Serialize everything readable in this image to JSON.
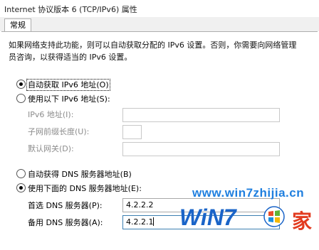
{
  "window": {
    "title": "Internet 协议版本 6 (TCP/IPv6) 属性"
  },
  "tabs": [
    {
      "label": "常规"
    }
  ],
  "description": "如果网络支持此功能，则可以自动获取分配的 IPv6 设置。否则，你需要向网络管理员咨询，以获得适当的 IPv6 设置。",
  "ip": {
    "auto_label": "自动获取 IPv6 地址(O)",
    "manual_label": "使用以下 IPv6 地址(S):",
    "selected": "auto",
    "address_label": "IPv6 地址(I):",
    "prefix_label": "子网前缀长度(U):",
    "gateway_label": "默认网关(D):",
    "address_value": "",
    "prefix_value": "",
    "gateway_value": ""
  },
  "dns": {
    "auto_label": "自动获得 DNS 服务器地址(B)",
    "manual_label": "使用下面的 DNS 服务器地址(E):",
    "selected": "manual",
    "preferred_label": "首选 DNS 服务器(P):",
    "alternate_label": "备用 DNS 服务器(A):",
    "preferred_value": "4.2.2.2",
    "alternate_value": "4.2.2.1"
  },
  "watermark": {
    "url": "www.win7zhijia.cn",
    "brand": "WiN7",
    "suffix": "家"
  },
  "colors": {
    "accent": "#3c7fb1",
    "watermark_blue": "#1a64c8",
    "watermark_red": "#e23b1f"
  }
}
